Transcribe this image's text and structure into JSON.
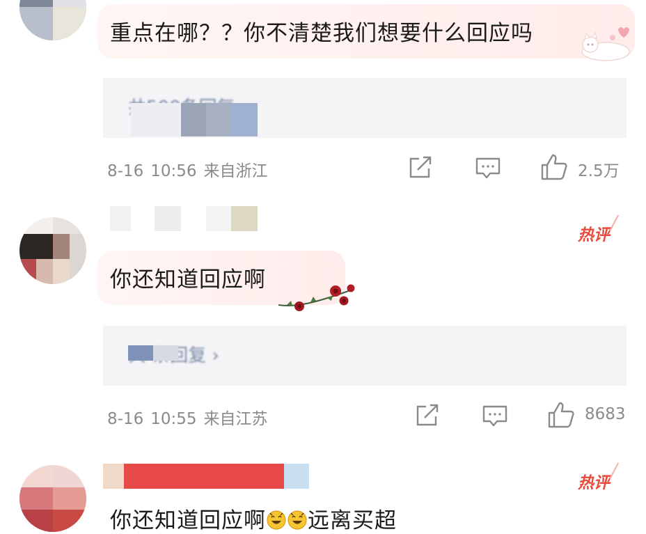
{
  "comments": [
    {
      "text": "重点在哪？？你不清楚我们想要什么回应吗",
      "replies_label": "共500条回复 ›",
      "date": "8-16",
      "time": "10:56",
      "location": "来自浙江",
      "likes": "2.5万"
    },
    {
      "badge": "热评",
      "text": "你还知道回应啊",
      "replies_label": "共 条回复 ›",
      "date": "8-16",
      "time": "10:55",
      "location": "来自江苏",
      "likes": "8683"
    },
    {
      "badge": "热评",
      "text": "你还知道回应啊",
      "text_after": "远离买超"
    }
  ],
  "icons": {
    "share": "share-icon",
    "reply": "comment-icon",
    "like": "thumbs-up-icon",
    "emoji": "grinning-face-icon",
    "decoration_cat": "cat-sticker-icon",
    "decoration_roses": "rose-vine-icon"
  },
  "colors": {
    "hot_badge": "#e84a3b",
    "meta_gray": "#8a8a8a",
    "replies_bg": "#f4f4f6",
    "bubble_pink": "#ffeceb"
  }
}
